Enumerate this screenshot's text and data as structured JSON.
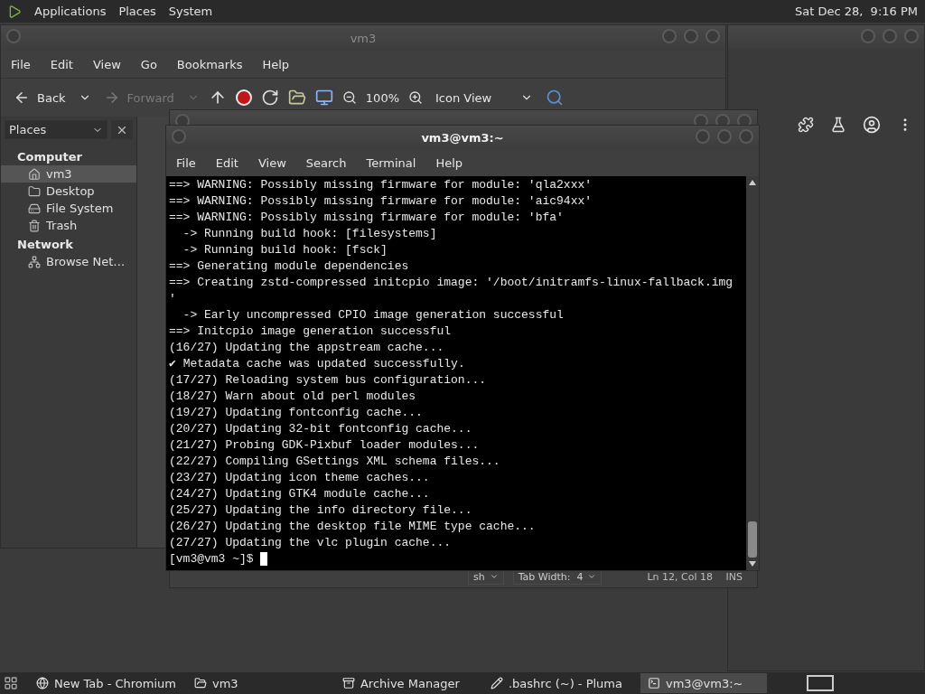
{
  "top_panel": {
    "menus": [
      "Applications",
      "Places",
      "System"
    ],
    "clock": "Sat Dec 28,  9:16 PM"
  },
  "file_manager": {
    "title": "vm3",
    "menu": [
      "File",
      "Edit",
      "View",
      "Go",
      "Bookmarks",
      "Help"
    ],
    "toolbar": {
      "back": "Back",
      "forward": "Forward",
      "forward_disabled": true,
      "zoom": "100%",
      "view": "Icon View"
    },
    "sidebar": {
      "selector": "Places",
      "sections": [
        {
          "heading": "Computer",
          "items": [
            {
              "label": "vm3",
              "kind": "home",
              "selected": true
            },
            {
              "label": "Desktop",
              "kind": "desktop",
              "selected": false
            },
            {
              "label": "File System",
              "kind": "drive",
              "selected": false
            },
            {
              "label": "Trash",
              "kind": "trash",
              "selected": false
            }
          ]
        },
        {
          "heading": "Network",
          "items": [
            {
              "label": "Browse Net…",
              "kind": "network",
              "selected": false
            }
          ]
        }
      ]
    }
  },
  "editor": {
    "status": {
      "language": "sh",
      "tab_width": "Tab Width:  4",
      "position": "Ln 12, Col 18",
      "mode": "INS"
    }
  },
  "terminal": {
    "title": "vm3@vm3:~",
    "menu": [
      "File",
      "Edit",
      "View",
      "Search",
      "Terminal",
      "Help"
    ],
    "lines": [
      "==> WARNING: Possibly missing firmware for module: 'qla2xxx'",
      "==> WARNING: Possibly missing firmware for module: 'aic94xx'",
      "==> WARNING: Possibly missing firmware for module: 'bfa'",
      "  -> Running build hook: [filesystems]",
      "  -> Running build hook: [fsck]",
      "==> Generating module dependencies",
      "==> Creating zstd-compressed initcpio image: '/boot/initramfs-linux-fallback.img",
      "'",
      "  -> Early uncompressed CPIO image generation successful",
      "==> Initcpio image generation successful",
      "(16/27) Updating the appstream cache...",
      "✔ Metadata cache was updated successfully.",
      "(17/27) Reloading system bus configuration...",
      "(18/27) Warn about old perl modules",
      "(19/27) Updating fontconfig cache...",
      "(20/27) Updating 32-bit fontconfig cache...",
      "(21/27) Probing GDK-Pixbuf loader modules...",
      "(22/27) Compiling GSettings XML schema files...",
      "(23/27) Updating icon theme caches...",
      "(24/27) Updating GTK4 module cache...",
      "(25/27) Updating the info directory file...",
      "(26/27) Updating the desktop file MIME type cache...",
      "(27/27) Updating the vlc plugin cache..."
    ],
    "prompt": "[vm3@vm3 ~]$ "
  },
  "taskbar": {
    "items": [
      {
        "label": "New Tab - Chromium",
        "kind": "browser",
        "selected": false
      },
      {
        "label": "vm3",
        "kind": "folder",
        "selected": false
      },
      {
        "label": "Archive Manager",
        "kind": "archive",
        "selected": false
      },
      {
        "label": ".bashrc (~) - Pluma",
        "kind": "editor",
        "selected": false
      },
      {
        "label": "vm3@vm3:~",
        "kind": "terminal",
        "selected": true
      }
    ]
  }
}
